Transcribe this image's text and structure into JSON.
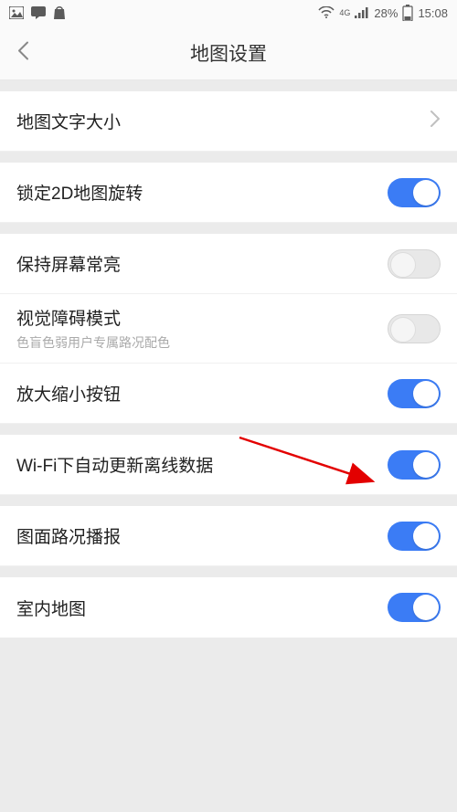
{
  "statusBar": {
    "battery": "28%",
    "time": "15:08",
    "networkLabel": "4G"
  },
  "navbar": {
    "title": "地图设置"
  },
  "groups": [
    {
      "rows": [
        {
          "label": "地图文字大小",
          "type": "chevron"
        }
      ]
    },
    {
      "rows": [
        {
          "label": "锁定2D地图旋转",
          "type": "toggle",
          "value": true
        }
      ]
    },
    {
      "rows": [
        {
          "label": "保持屏幕常亮",
          "type": "toggle",
          "value": false
        },
        {
          "label": "视觉障碍模式",
          "sublabel": "色盲色弱用户专属路况配色",
          "type": "toggle",
          "value": false
        },
        {
          "label": "放大缩小按钮",
          "type": "toggle",
          "value": true
        }
      ]
    },
    {
      "rows": [
        {
          "label": "Wi-Fi下自动更新离线数据",
          "type": "toggle",
          "value": true
        }
      ]
    },
    {
      "rows": [
        {
          "label": "图面路况播报",
          "type": "toggle",
          "value": true
        }
      ]
    },
    {
      "rows": [
        {
          "label": "室内地图",
          "type": "toggle",
          "value": true
        }
      ]
    }
  ]
}
